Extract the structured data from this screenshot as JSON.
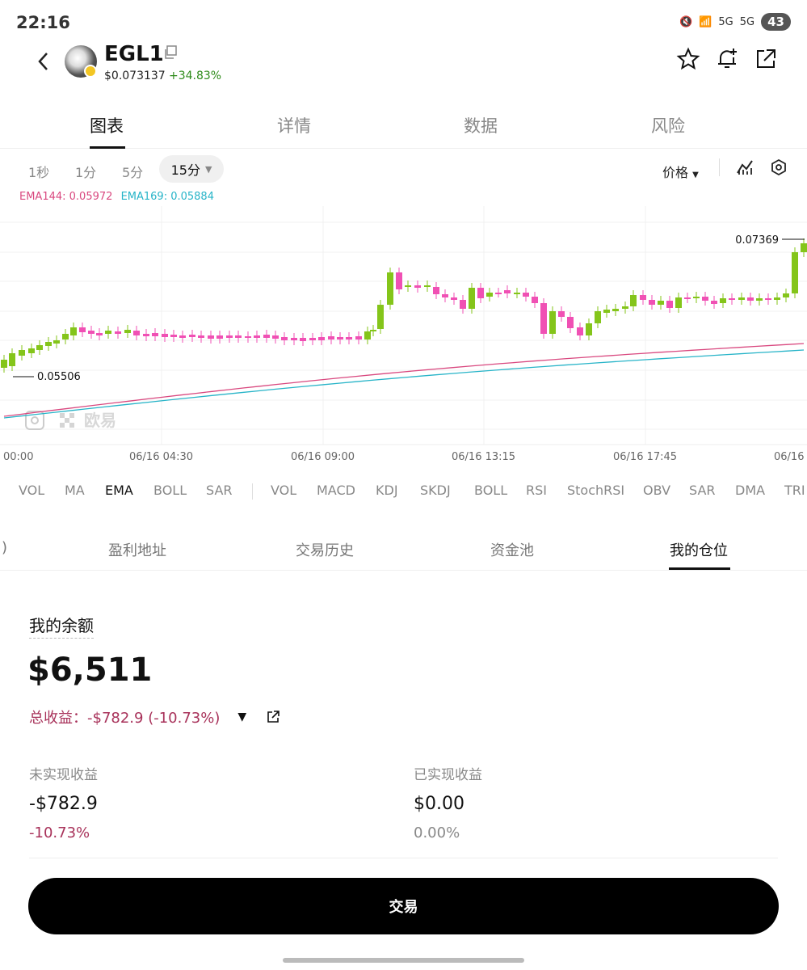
{
  "status_bar": {
    "time": "22:16",
    "signal_a": "5G",
    "signal_b": "5G",
    "battery": "43"
  },
  "header": {
    "token_name": "EGL1",
    "price": "$0.073137",
    "change": "+34.83%",
    "icons": [
      "star-icon",
      "bell-plus-icon",
      "share-icon"
    ]
  },
  "main_tabs": [
    "图表",
    "详情",
    "数据",
    "风险"
  ],
  "intervals": {
    "items": [
      "1秒",
      "1分",
      "5分"
    ],
    "selected": "15分"
  },
  "price_select": "价格",
  "ema_legend": {
    "ema144": "EMA144: 0.05972",
    "ema169": "EMA169: 0.05884"
  },
  "chart_labels": {
    "high": "0.07369",
    "low": "0.05506",
    "watermark": "欧易"
  },
  "x_ticks": [
    "00:00",
    "06/16 04:30",
    "06/16 09:00",
    "06/16 13:15",
    "06/16 17:45",
    "06/16"
  ],
  "indicators_main": [
    "VOL",
    "MA",
    "EMA",
    "BOLL",
    "SAR"
  ],
  "indicators_sub": [
    "VOL",
    "MACD",
    "KDJ",
    "SKDJ",
    "BOLL",
    "RSI",
    "StochRSI",
    "OBV",
    "SAR",
    "DMA",
    "TRI"
  ],
  "sub_tabs": [
    ")",
    "盈利地址",
    "交易历史",
    "资金池",
    "我的仓位"
  ],
  "balance": {
    "label": "我的余额",
    "value": "$6,511",
    "total_pnl": "总收益：-$782.9 (-10.73%)",
    "unrealized_label": "未实现收益",
    "unrealized_value": "-$782.9",
    "unrealized_pct": "-10.73%",
    "realized_label": "已实现收益",
    "realized_value": "$0.00",
    "realized_pct": "0.00%"
  },
  "trade_button": "交易",
  "colors": {
    "up": "#84c51a",
    "down": "#f050b4",
    "ema144": "#d9487f",
    "ema169": "#27b4c8",
    "negative": "#a8325a",
    "positive": "#2e8b1a"
  }
}
